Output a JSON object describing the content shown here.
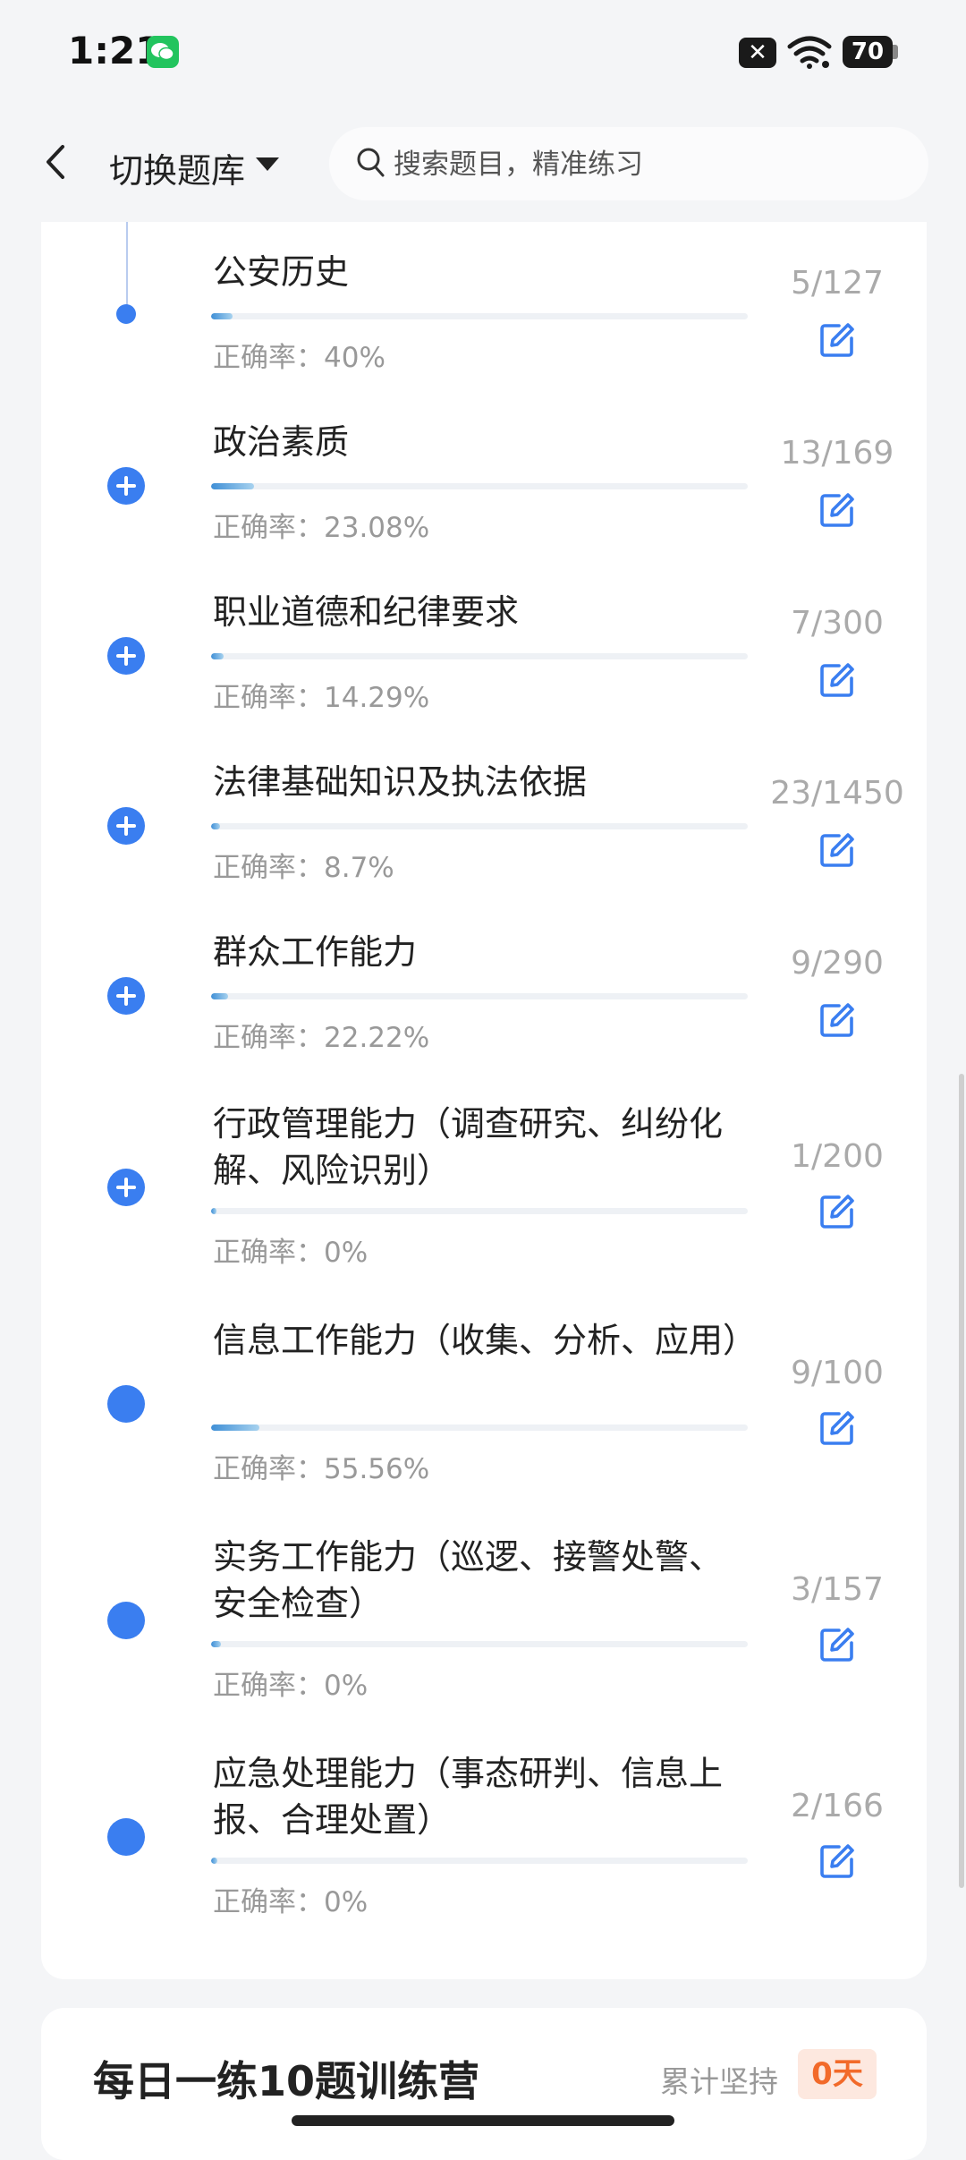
{
  "status_bar": {
    "time": "1:21",
    "battery": "70"
  },
  "header": {
    "switch_label": "切换题库",
    "search_placeholder": "搜索题目，精准练习"
  },
  "items": [
    {
      "title": "公安历史",
      "accuracy": "正确率：40%",
      "count": "5/127",
      "progress": 0.04,
      "marker": "dot-small"
    },
    {
      "title": "政治素质",
      "accuracy": "正确率：23.08%",
      "count": "13/169",
      "progress": 0.08,
      "marker": "plus"
    },
    {
      "title": "职业道德和纪律要求",
      "accuracy": "正确率：14.29%",
      "count": "7/300",
      "progress": 0.023,
      "marker": "plus"
    },
    {
      "title": "法律基础知识及执法依据",
      "accuracy": "正确率：8.7%",
      "count": "23/1450",
      "progress": 0.016,
      "marker": "plus"
    },
    {
      "title": "群众工作能力",
      "accuracy": "正确率：22.22%",
      "count": "9/290",
      "progress": 0.031,
      "marker": "plus"
    },
    {
      "title": "行政管理能力（调查研究、纠纷化解、风险识别）",
      "accuracy": "正确率：0%",
      "count": "1/200",
      "progress": 0.005,
      "marker": "plus"
    },
    {
      "title": "信息工作能力（收集、分析、应用）",
      "accuracy": "正确率：55.56%",
      "count": "9/100",
      "progress": 0.09,
      "marker": "dot"
    },
    {
      "title": "实务工作能力（巡逻、接警处警、安全检查）",
      "accuracy": "正确率：0%",
      "count": "3/157",
      "progress": 0.019,
      "marker": "dot"
    },
    {
      "title": "应急处理能力（事态研判、信息上报、合理处置）",
      "accuracy": "正确率：0%",
      "count": "2/166",
      "progress": 0.012,
      "marker": "dot"
    }
  ],
  "camp": {
    "title": "每日一练10题训练营",
    "streak_label": "累计坚持",
    "streak_value": "0天"
  },
  "colors": {
    "accent": "#3a7ef0",
    "streak_text": "#f26a2a",
    "streak_bg": "#fde8df"
  },
  "icons": {
    "edit": "edit-icon",
    "back": "back-arrow-icon",
    "search": "search-icon"
  }
}
